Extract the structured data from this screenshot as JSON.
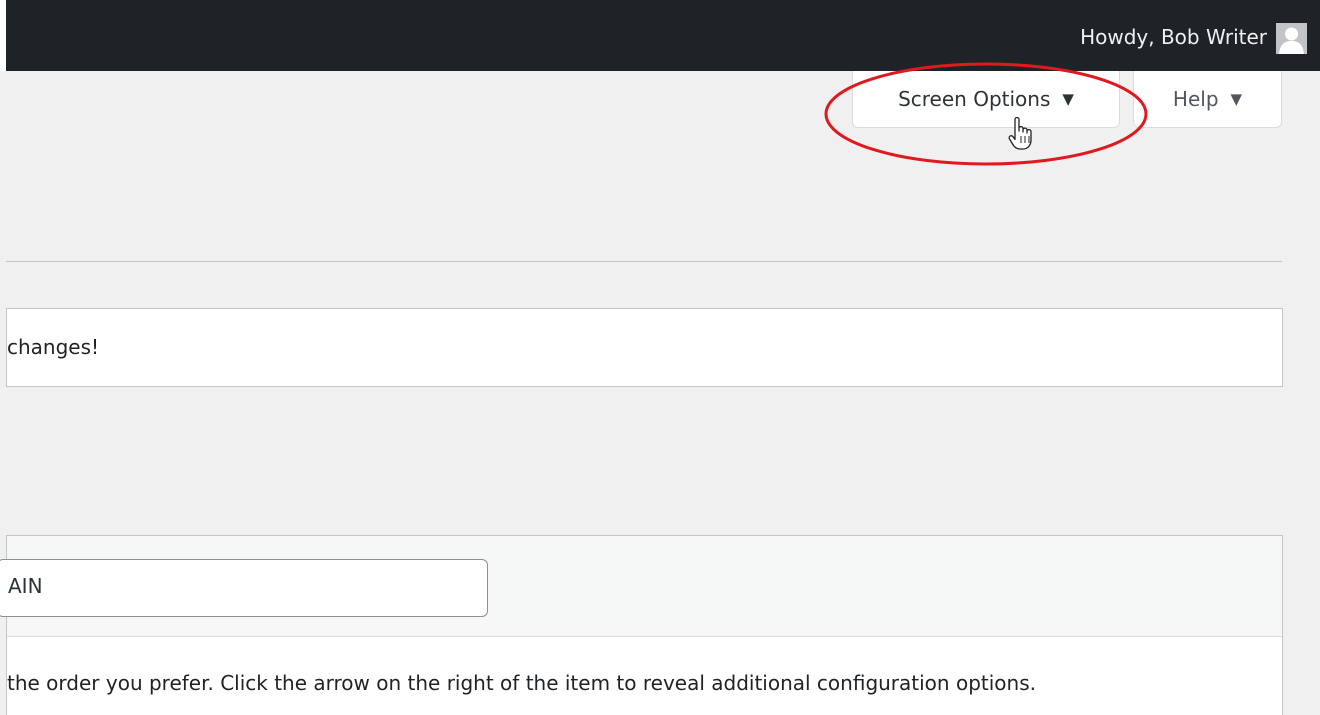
{
  "admin_bar": {
    "greeting": "Howdy, Bob Writer",
    "avatar_icon": "user-avatar-icon"
  },
  "screen_meta": {
    "screen_options_label": "Screen Options",
    "help_label": "Help",
    "caret_glyph": "▼"
  },
  "notice": {
    "text": "changes!"
  },
  "menu_edit": {
    "menu_name_value": "AIN",
    "instructions": "the order you prefer. Click the arrow on the right of the item to reveal additional configuration options."
  },
  "annotation": {
    "highlight_color": "#e0191f",
    "cursor_icon": "hand-pointer-icon"
  }
}
